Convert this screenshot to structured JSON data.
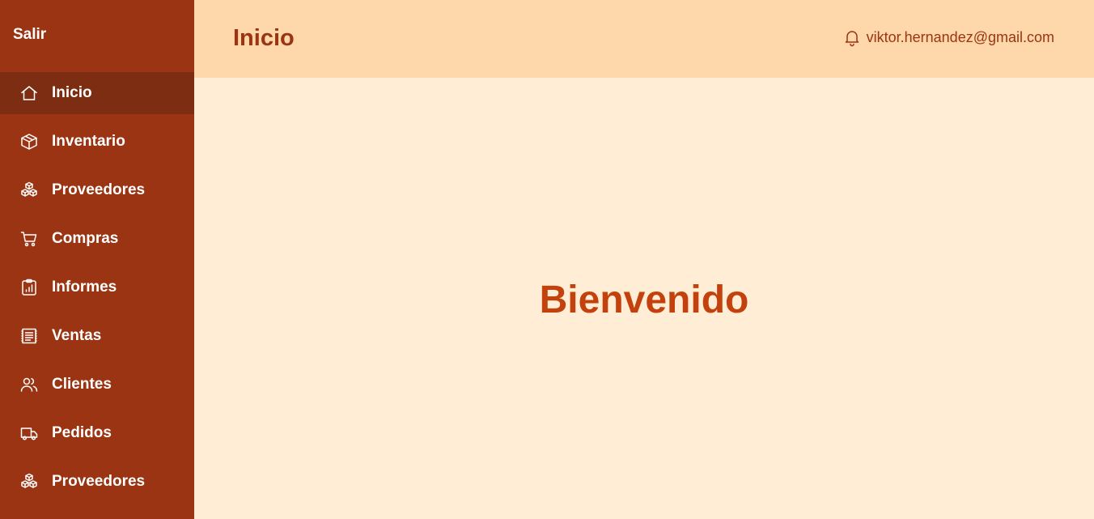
{
  "sidebar": {
    "logout_label": "Salir",
    "items": [
      {
        "label": "Inicio",
        "icon": "home-icon",
        "active": true
      },
      {
        "label": "Inventario",
        "icon": "cube-icon",
        "active": false
      },
      {
        "label": "Proveedores",
        "icon": "cubes-icon",
        "active": false
      },
      {
        "label": "Compras",
        "icon": "cart-icon",
        "active": false
      },
      {
        "label": "Informes",
        "icon": "report-icon",
        "active": false
      },
      {
        "label": "Ventas",
        "icon": "receipt-icon",
        "active": false
      },
      {
        "label": "Clientes",
        "icon": "users-icon",
        "active": false
      },
      {
        "label": "Pedidos",
        "icon": "truck-icon",
        "active": false
      },
      {
        "label": "Proveedores",
        "icon": "cubes-icon",
        "active": false
      }
    ]
  },
  "header": {
    "title": "Inicio",
    "user_email": "viktor.hernandez@gmail.com",
    "notification_icon": "bell-icon"
  },
  "main": {
    "welcome": "Bienvenido"
  },
  "colors": {
    "sidebar_bg": "#9A3412",
    "sidebar_active_bg": "#7C2D12",
    "header_bg": "#FED7AA",
    "content_bg": "#FFEDD5",
    "title_color": "#9A3412",
    "welcome_color": "#C2410C"
  }
}
